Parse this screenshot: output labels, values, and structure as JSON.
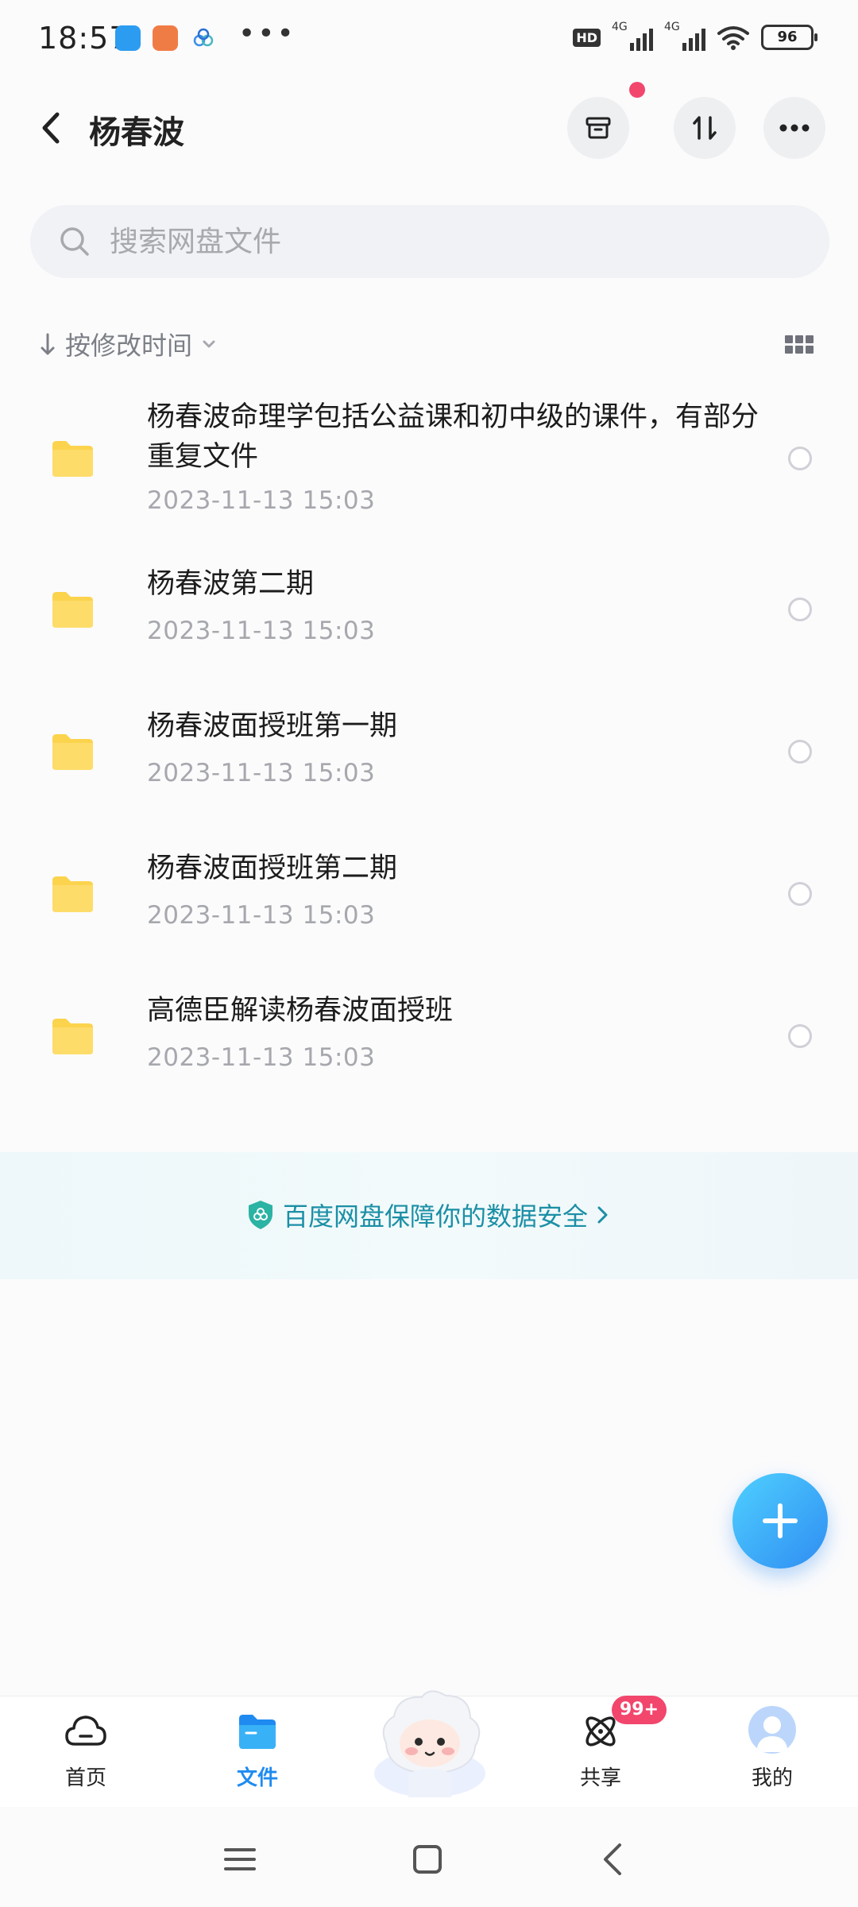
{
  "status_bar": {
    "time": "18:57",
    "hd": "HD",
    "net1": "4G",
    "net2": "4G",
    "battery": "96"
  },
  "header": {
    "title": "杨春波"
  },
  "search": {
    "placeholder": "搜索网盘文件"
  },
  "sort": {
    "label": "按修改时间"
  },
  "files": [
    {
      "name": "杨春波命理学包括公益课和初中级的课件，有部分重复文件",
      "date": "2023-11-13  15:03"
    },
    {
      "name": "杨春波第二期",
      "date": "2023-11-13  15:03"
    },
    {
      "name": "杨春波面授班第一期",
      "date": "2023-11-13  15:03"
    },
    {
      "name": "杨春波面授班第二期",
      "date": "2023-11-13  15:03"
    },
    {
      "name": "高德臣解读杨春波面授班",
      "date": "2023-11-13  15:03"
    }
  ],
  "safety_banner": {
    "text": "百度网盘保障你的数据安全"
  },
  "tabbar": {
    "home": "首页",
    "files": "文件",
    "share": "共享",
    "share_badge": "99+",
    "mine": "我的"
  },
  "colors": {
    "accent": "#1f8bf0",
    "folder": "#fcd34d",
    "badge": "#f2466d",
    "safety_text": "#1b8fa6"
  }
}
